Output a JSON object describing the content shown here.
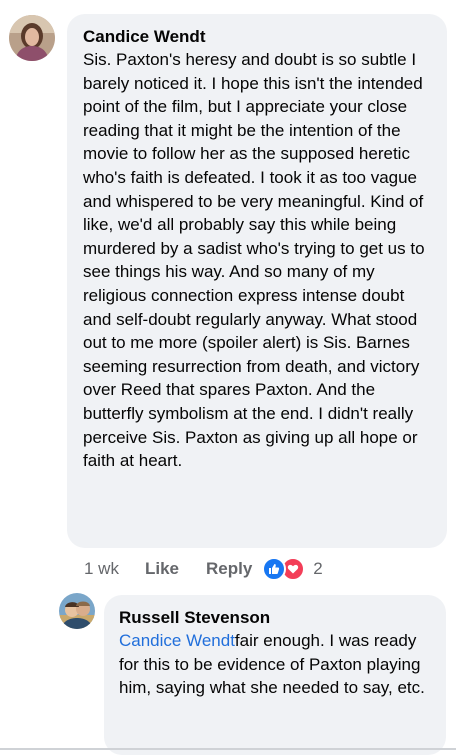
{
  "comment": {
    "author": "Candice Wendt",
    "text": "Sis. Paxton's heresy and doubt is so subtle I barely noticed it. I hope this isn't the intended point of the film, but I appreciate your close reading that it might be the intention of the movie to follow her as the supposed heretic who's faith is defeated. I took it as too vague and whispered to be very meaningful. Kind of like, we'd all probably say this while being murdered by a sadist who's trying to get us to see things his way. And so many of my religious connection express intense doubt and self-doubt regularly anyway. What stood out to me more (spoiler alert) is Sis. Barnes seeming resurrection from death, and victory over Reed that spares Paxton. And the butterfly symbolism at the end. I didn't really perceive Sis. Paxton as giving up all hope or faith at heart.",
    "time": "1 wk",
    "like_label": "Like",
    "reply_label": "Reply",
    "reaction_count": "2",
    "reactions": [
      "like-icon",
      "love-icon"
    ]
  },
  "reply": {
    "author": "Russell Stevenson",
    "mention": "Candice Wendt",
    "text": "fair enough. I  was ready for this to be evidence of Paxton playing him, saying what she needed to say, etc."
  },
  "colors": {
    "bubble": "#f0f2f5",
    "mention": "#216fdb",
    "like": "#1877f2",
    "love": "#f33e58",
    "meta": "#65676b"
  }
}
